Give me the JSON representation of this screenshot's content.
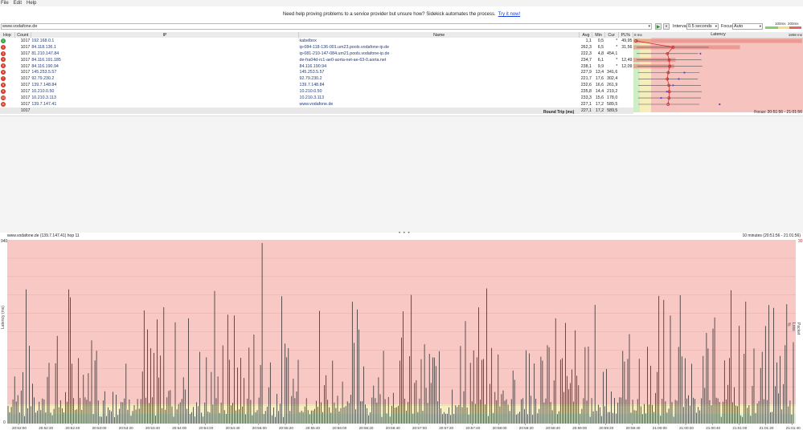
{
  "menu": [
    "File",
    "Edit",
    "Help"
  ],
  "banner": {
    "text": "Need help proving problems to a service provider but unsure how? Sidekick automates the process.",
    "link": "Try it now!"
  },
  "toolbar": {
    "address": "www.vodafone.de",
    "interval_label": "Interval",
    "interval_value": "0.5 seconds",
    "focus_label": "Focus",
    "focus_value": "Auto",
    "legend_100": "100ms",
    "legend_200": "200ms"
  },
  "columns": {
    "hop": "Hop",
    "count": "Count",
    "ip": "IP",
    "name": "Name",
    "avg": "Avg",
    "min": "Min",
    "cur": "Cur",
    "pl": "PL%",
    "latency": "Latency",
    "lat_min": "0 ms",
    "lat_max": "1908 ms"
  },
  "hops": [
    {
      "hop": "1",
      "count": "1017",
      "ip": "192.168.0.1",
      "name": "kabelbox",
      "avg": "1,1",
      "min": "0,5",
      "cur": "*",
      "pl": "49,95",
      "status": "green"
    },
    {
      "hop": "2",
      "count": "1017",
      "ip": "84.118.136.1",
      "name": "ip-084-118-136-001.um23.pools.vodafone-ip.de",
      "avg": "262,3",
      "min": "6,5",
      "cur": "*",
      "pl": "31,56",
      "status": "red"
    },
    {
      "hop": "3",
      "count": "1017",
      "ip": "81.210.147.84",
      "name": "ip-081-210-147-084.um21.pools.vodafone-ip.de",
      "avg": "222,3",
      "min": "4,8",
      "cur": "454,1",
      "pl": "",
      "status": "red"
    },
    {
      "hop": "4",
      "count": "1017",
      "ip": "84.116.191.185",
      "name": "de-fra04d-rc1-ae0-aorta-net-ae-63-0.aorta.net",
      "avg": "234,7",
      "min": "6,1",
      "cur": "*",
      "pl": "12,49",
      "status": "red"
    },
    {
      "hop": "5",
      "count": "1017",
      "ip": "84.116.190.94",
      "name": "84.116.190.94",
      "avg": "238,1",
      "min": "9,9",
      "cur": "*",
      "pl": "12,09",
      "status": "red"
    },
    {
      "hop": "6",
      "count": "1017",
      "ip": "145.253.5.57",
      "name": "145.253.5.57",
      "avg": "227,9",
      "min": "13,4",
      "cur": "341,6",
      "pl": "",
      "status": "red"
    },
    {
      "hop": "7",
      "count": "1017",
      "ip": "92.79.230.2",
      "name": "92.79.230.2",
      "avg": "221,7",
      "min": "17,6",
      "cur": "302,4",
      "pl": "",
      "status": "red"
    },
    {
      "hop": "8",
      "count": "1017",
      "ip": "139.7.148.84",
      "name": "139.7.148.84",
      "avg": "232,6",
      "min": "16,6",
      "cur": "261,9",
      "pl": "",
      "status": "red"
    },
    {
      "hop": "9",
      "count": "1017",
      "ip": "10.210.0.50",
      "name": "10.210.0.50",
      "avg": "235,8",
      "min": "14,4",
      "cur": "219,2",
      "pl": "",
      "status": "red"
    },
    {
      "hop": "10",
      "count": "1017",
      "ip": "10.210.3.113",
      "name": "10.210.3.113",
      "avg": "233,3",
      "min": "15,6",
      "cur": "178,0",
      "pl": "",
      "status": "red"
    },
    {
      "hop": "11",
      "count": "1017",
      "ip": "139.7.147.41",
      "name": "www.vodafone.de",
      "avg": "227,1",
      "min": "17,2",
      "cur": "589,5",
      "pl": "",
      "status": "red"
    }
  ],
  "summary": {
    "count": "1017",
    "label": "Round Trip (ms)",
    "avg": "227,1",
    "min": "17,2",
    "cur": "589,5",
    "focus": "Focus: 20:51:56 - 21:01:56"
  },
  "graph": {
    "title": "www.vodafone.de (139.7.147.41) hop 11",
    "range": "10 minutes (20:51:56 - 21:01:56)",
    "ylabel": "Latency (ms)",
    "y2label": "Packet Loss %",
    "ymax_label": "940",
    "y2max_label": "30",
    "ymin_label": "0",
    "xticks": [
      "20:52:00",
      "20:52:20",
      "20:52:40",
      "20:53:00",
      "20:53:20",
      "20:53:40",
      "20:54:00",
      "20:54:20",
      "20:54:40",
      "20:55:00",
      "20:55:20",
      "20:55:40",
      "20:56:00",
      "20:56:20",
      "20:56:40",
      "20:57:00",
      "20:57:20",
      "20:57:40",
      "20:58:00",
      "20:58:20",
      "20:58:40",
      "20:59:00",
      "20:59:20",
      "20:59:40",
      "21:00:00",
      "21:00:20",
      "21:00:40",
      "21:01:00",
      "21:01:20",
      "21:01:40"
    ]
  },
  "colors": {
    "red_zone": "#f8c8c4",
    "yellow_zone": "#f8efc0",
    "green_zone": "#d9efcf",
    "bar": "#1a1a1a"
  }
}
